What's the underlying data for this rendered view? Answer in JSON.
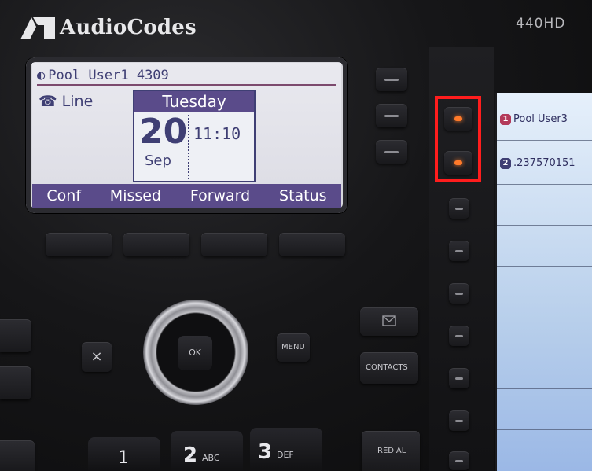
{
  "brand": {
    "name": "AudioCodes",
    "model": "440HD"
  },
  "lcd": {
    "header_text": "Pool User1 4309",
    "line_label": "Line",
    "calendar": {
      "weekday": "Tuesday",
      "day": "20",
      "month": "Sep",
      "time": "11:10"
    },
    "softkeys": [
      "Conf",
      "Missed",
      "Forward",
      "Status"
    ]
  },
  "bls": {
    "entries": [
      {
        "number": "1",
        "label": "Pool User3"
      },
      {
        "number": "2",
        "label": ".237570151"
      }
    ]
  },
  "keys": {
    "ok_label": "OK",
    "menu_label": "MENU",
    "contacts_label": "CONTACTS",
    "redial_label": "REDIAL",
    "cancel_glyph": "×",
    "digits": [
      {
        "digit": "1",
        "letters": ""
      },
      {
        "digit": "2",
        "letters": "ABC"
      },
      {
        "digit": "3",
        "letters": "DEF"
      }
    ]
  },
  "colors": {
    "lcd_accent": "#5a4b8a",
    "led_active": "#ff7a2a",
    "highlight_box": "#ff1d1d"
  }
}
